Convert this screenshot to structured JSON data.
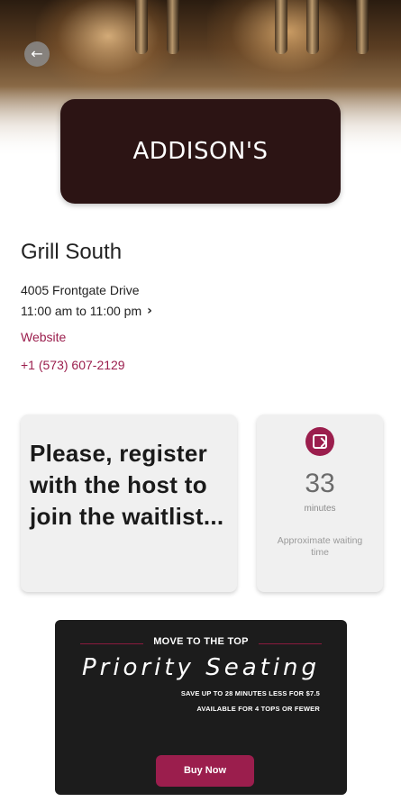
{
  "header": {
    "back_icon": "arrow-left-icon",
    "back_glyph": "←"
  },
  "restaurant": {
    "logo_text": "ADDISON'S",
    "name": "Grill South",
    "address": "4005 Frontgate Drive",
    "hours": "11:00 am to 11:00 pm",
    "hours_chevron": "›",
    "website_label": "Website",
    "phone": "+1 (573) 607-2129"
  },
  "waitlist": {
    "message": "Please, register with the host to join the waitlist...",
    "icon": "waitlist-icon",
    "wait_value": "33",
    "wait_unit": "minutes",
    "wait_caption": "Approximate waiting time"
  },
  "promo": {
    "kicker": "MOVE TO THE TOP",
    "title": "Priority Seating",
    "line1": "SAVE UP TO 28 MINUTES LESS FOR $7.5",
    "line2": "AVAILABLE FOR 4 TOPS OR FEWER",
    "button_label": "Buy Now"
  },
  "colors": {
    "accent": "#9b1e4d",
    "logo_bg": "#2c1414",
    "promo_bg": "#1c1c1c"
  }
}
